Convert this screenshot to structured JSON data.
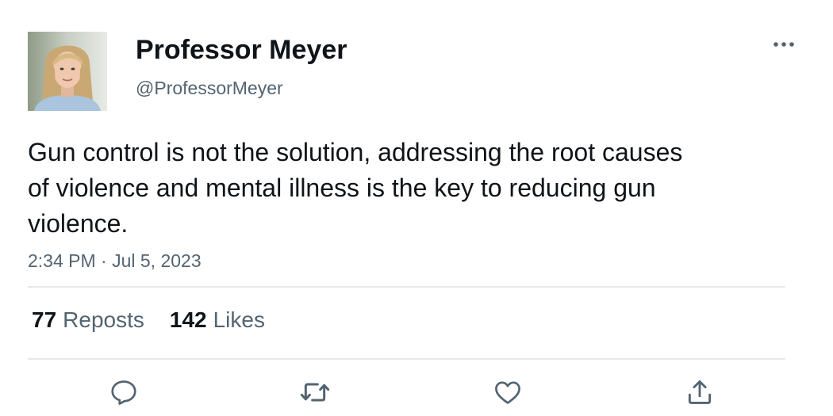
{
  "author": {
    "display_name": "Professor Meyer",
    "handle": "@ProfessorMeyer",
    "avatar_icon": "profile-photo"
  },
  "tweet": {
    "text": "Gun control is not the solution, addressing the root causes of violence and mental illness is the key to reducing gun violence.",
    "timestamp": "2:34 PM · Jul 5, 2023"
  },
  "stats": {
    "reposts_count": "77",
    "reposts_label": "Reposts",
    "likes_count": "142",
    "likes_label": "Likes"
  },
  "actions": {
    "reply_icon": "reply-icon",
    "repost_icon": "repost-icon",
    "like_icon": "heart-icon",
    "share_icon": "share-icon"
  },
  "colors": {
    "primary_text": "#0f1419",
    "secondary_text": "#536471",
    "divider": "#e6e9eb"
  }
}
